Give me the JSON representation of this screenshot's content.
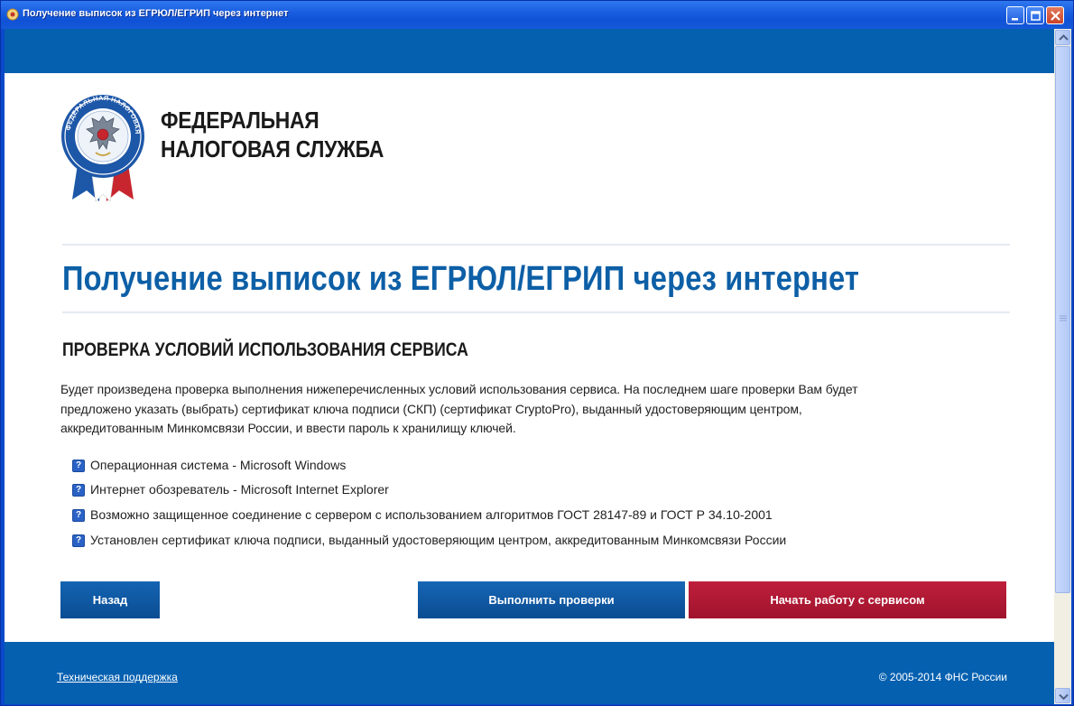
{
  "window": {
    "title": "Получение выписок из ЕГРЮЛ/ЕГРИП через интернет"
  },
  "header": {
    "brand_line1": "ФЕДЕРАЛЬНАЯ",
    "brand_line2": "НАЛОГОВАЯ СЛУЖБА",
    "logo_text": "ФЕДЕРАЛЬНАЯ НАЛОГОВАЯ СЛУЖБА"
  },
  "main": {
    "page_title": "Получение выписок из ЕГРЮЛ/ЕГРИП через интернет",
    "section_title": "ПРОВЕРКА УСЛОВИЙ ИСПОЛЬЗОВАНИЯ СЕРВИСА",
    "intro_line1": "Будет произведена проверка выполнения нижеперечисленных условий использования сервиса. На последнем шаге проверки Вам будет",
    "intro_line2": "предложено указать (выбрать) сертификат ключа подписи (СКП) (сертификат CryptoPro), выданный удостоверяющим центром,",
    "intro_line3": "аккредитованным Минкомсвязи России, и ввести пароль к хранилищу ключей.",
    "checks": [
      {
        "icon": "?",
        "label": "Операционная система - Microsoft Windows"
      },
      {
        "icon": "?",
        "label": "Интернет обозреватель - Microsoft Internet Explorer"
      },
      {
        "icon": "?",
        "label": "Возможно защищенное соединение с сервером с использованием алгоритмов ГОСТ 28147-89 и ГОСТ Р 34.10-2001"
      },
      {
        "icon": "?",
        "label": "Установлен сертификат ключа подписи, выданный удостоверяющим центром, аккредитованным Минкомсвязи России"
      }
    ],
    "buttons": {
      "back": "Назад",
      "run_checks": "Выполнить проверки",
      "start": "Начать работу с сервисом"
    }
  },
  "footer": {
    "support_link": "Техническая поддержка",
    "copyright": "© 2005-2014 ФНС России"
  },
  "colors": {
    "brand_blue": "#0560b0",
    "title_blue": "#0d5fa6",
    "start_red": "#b01a35",
    "xp_titlebar": "#1a5ee0"
  }
}
